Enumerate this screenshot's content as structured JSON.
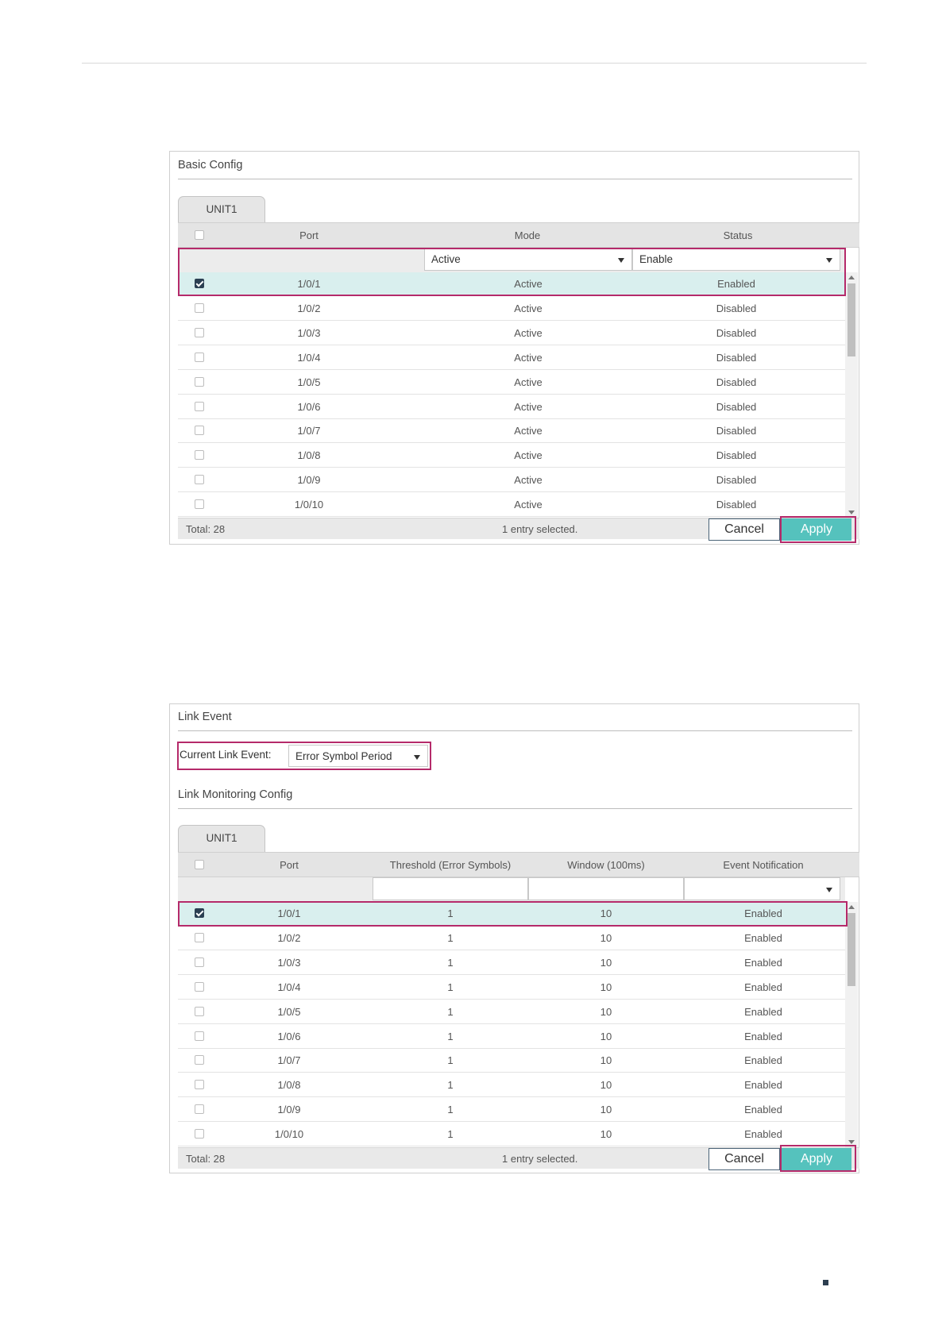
{
  "basic_config": {
    "title": "Basic Config",
    "tab": "UNIT1",
    "columns": [
      "Port",
      "Mode",
      "Status"
    ],
    "filter": {
      "mode": "Active",
      "status": "Enable"
    },
    "rows": [
      {
        "port": "1/0/1",
        "mode": "Active",
        "status": "Enabled",
        "checked": true
      },
      {
        "port": "1/0/2",
        "mode": "Active",
        "status": "Disabled",
        "checked": false
      },
      {
        "port": "1/0/3",
        "mode": "Active",
        "status": "Disabled",
        "checked": false
      },
      {
        "port": "1/0/4",
        "mode": "Active",
        "status": "Disabled",
        "checked": false
      },
      {
        "port": "1/0/5",
        "mode": "Active",
        "status": "Disabled",
        "checked": false
      },
      {
        "port": "1/0/6",
        "mode": "Active",
        "status": "Disabled",
        "checked": false
      },
      {
        "port": "1/0/7",
        "mode": "Active",
        "status": "Disabled",
        "checked": false
      },
      {
        "port": "1/0/8",
        "mode": "Active",
        "status": "Disabled",
        "checked": false
      },
      {
        "port": "1/0/9",
        "mode": "Active",
        "status": "Disabled",
        "checked": false
      },
      {
        "port": "1/0/10",
        "mode": "Active",
        "status": "Disabled",
        "checked": false
      }
    ],
    "total": "Total: 28",
    "selected": "1 entry selected.",
    "cancel": "Cancel",
    "apply": "Apply"
  },
  "link_event": {
    "title": "Link Event",
    "current_label": "Current Link Event:",
    "current_value": "Error Symbol Period",
    "monitoring_title": "Link Monitoring Config",
    "tab": "UNIT1",
    "columns": [
      "Port",
      "Threshold (Error Symbols)",
      "Window (100ms)",
      "Event Notification"
    ],
    "rows": [
      {
        "port": "1/0/1",
        "threshold": "1",
        "window": "10",
        "notification": "Enabled",
        "checked": true
      },
      {
        "port": "1/0/2",
        "threshold": "1",
        "window": "10",
        "notification": "Enabled",
        "checked": false
      },
      {
        "port": "1/0/3",
        "threshold": "1",
        "window": "10",
        "notification": "Enabled",
        "checked": false
      },
      {
        "port": "1/0/4",
        "threshold": "1",
        "window": "10",
        "notification": "Enabled",
        "checked": false
      },
      {
        "port": "1/0/5",
        "threshold": "1",
        "window": "10",
        "notification": "Enabled",
        "checked": false
      },
      {
        "port": "1/0/6",
        "threshold": "1",
        "window": "10",
        "notification": "Enabled",
        "checked": false
      },
      {
        "port": "1/0/7",
        "threshold": "1",
        "window": "10",
        "notification": "Enabled",
        "checked": false
      },
      {
        "port": "1/0/8",
        "threshold": "1",
        "window": "10",
        "notification": "Enabled",
        "checked": false
      },
      {
        "port": "1/0/9",
        "threshold": "1",
        "window": "10",
        "notification": "Enabled",
        "checked": false
      },
      {
        "port": "1/0/10",
        "threshold": "1",
        "window": "10",
        "notification": "Enabled",
        "checked": false
      }
    ],
    "total": "Total: 28",
    "selected": "1 entry selected.",
    "cancel": "Cancel",
    "apply": "Apply"
  },
  "colors": {
    "highlight": "#b52a6a",
    "apply": "#55c2bd",
    "selected_row": "#d9efee",
    "checkbox_on": "#2b3f52"
  }
}
